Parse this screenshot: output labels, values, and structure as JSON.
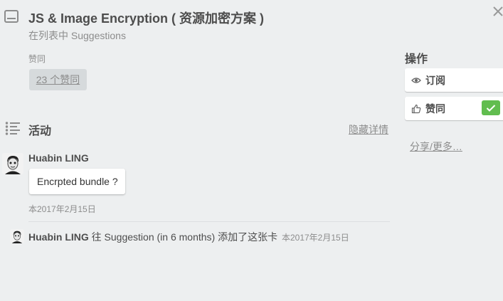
{
  "card": {
    "title": "JS & Image Encryption ( 资源加密方案 )",
    "list_prefix": "在列表中 ",
    "list_name": "Suggestions"
  },
  "votes": {
    "label": "赞同",
    "badge": "23 个赞同"
  },
  "activity": {
    "title": "活动",
    "hide_details": "隐藏详情",
    "comment": {
      "author": "Huabin LING",
      "text": "Encrpted bundle ?",
      "date": "本2017年2月15日"
    },
    "action": {
      "author": "Huabin LING",
      "text": " 往 Suggestion (in 6 months) 添加了这张卡 ",
      "date": "本2017年2月15日"
    }
  },
  "sidebar": {
    "heading": "操作",
    "subscribe_label": "订阅",
    "vote_label": "赞同",
    "vote_checked": true,
    "share_more": "分享/更多…"
  },
  "colors": {
    "background": "#edeff0",
    "check_green": "#61bd4f",
    "muted_text": "#8c8c8c"
  },
  "icons": [
    "card-icon",
    "close-icon",
    "activity-list-icon",
    "eye-icon",
    "thumbs-up-icon",
    "checkmark-icon"
  ]
}
